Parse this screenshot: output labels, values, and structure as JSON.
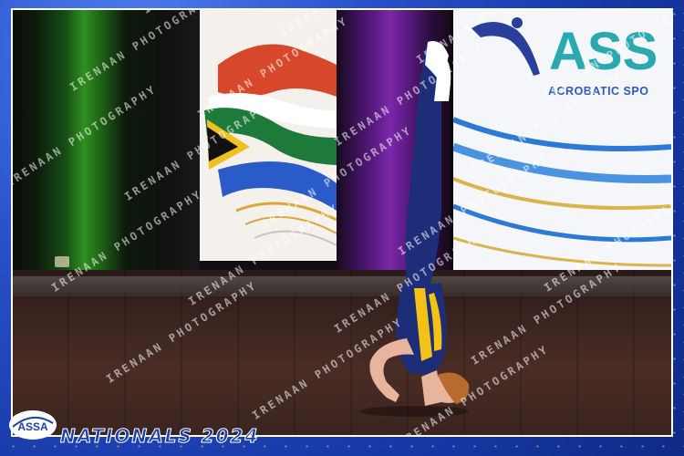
{
  "photo": {
    "banner_text": "ACROBATIC SPO",
    "banner_logo_text": "ASS"
  },
  "overlay": {
    "watermark": "IRENAAN PHOTOGRAPHY",
    "logo_text": "ASSA",
    "event_title": "NATIONALS 2024"
  },
  "colors": {
    "frame_blue": "#1d3fa8",
    "curtain_green": "#2e8f1f",
    "curtain_purple": "#7a28a8",
    "leotard_navy": "#1e2d78",
    "leotard_yellow": "#f2c316"
  }
}
